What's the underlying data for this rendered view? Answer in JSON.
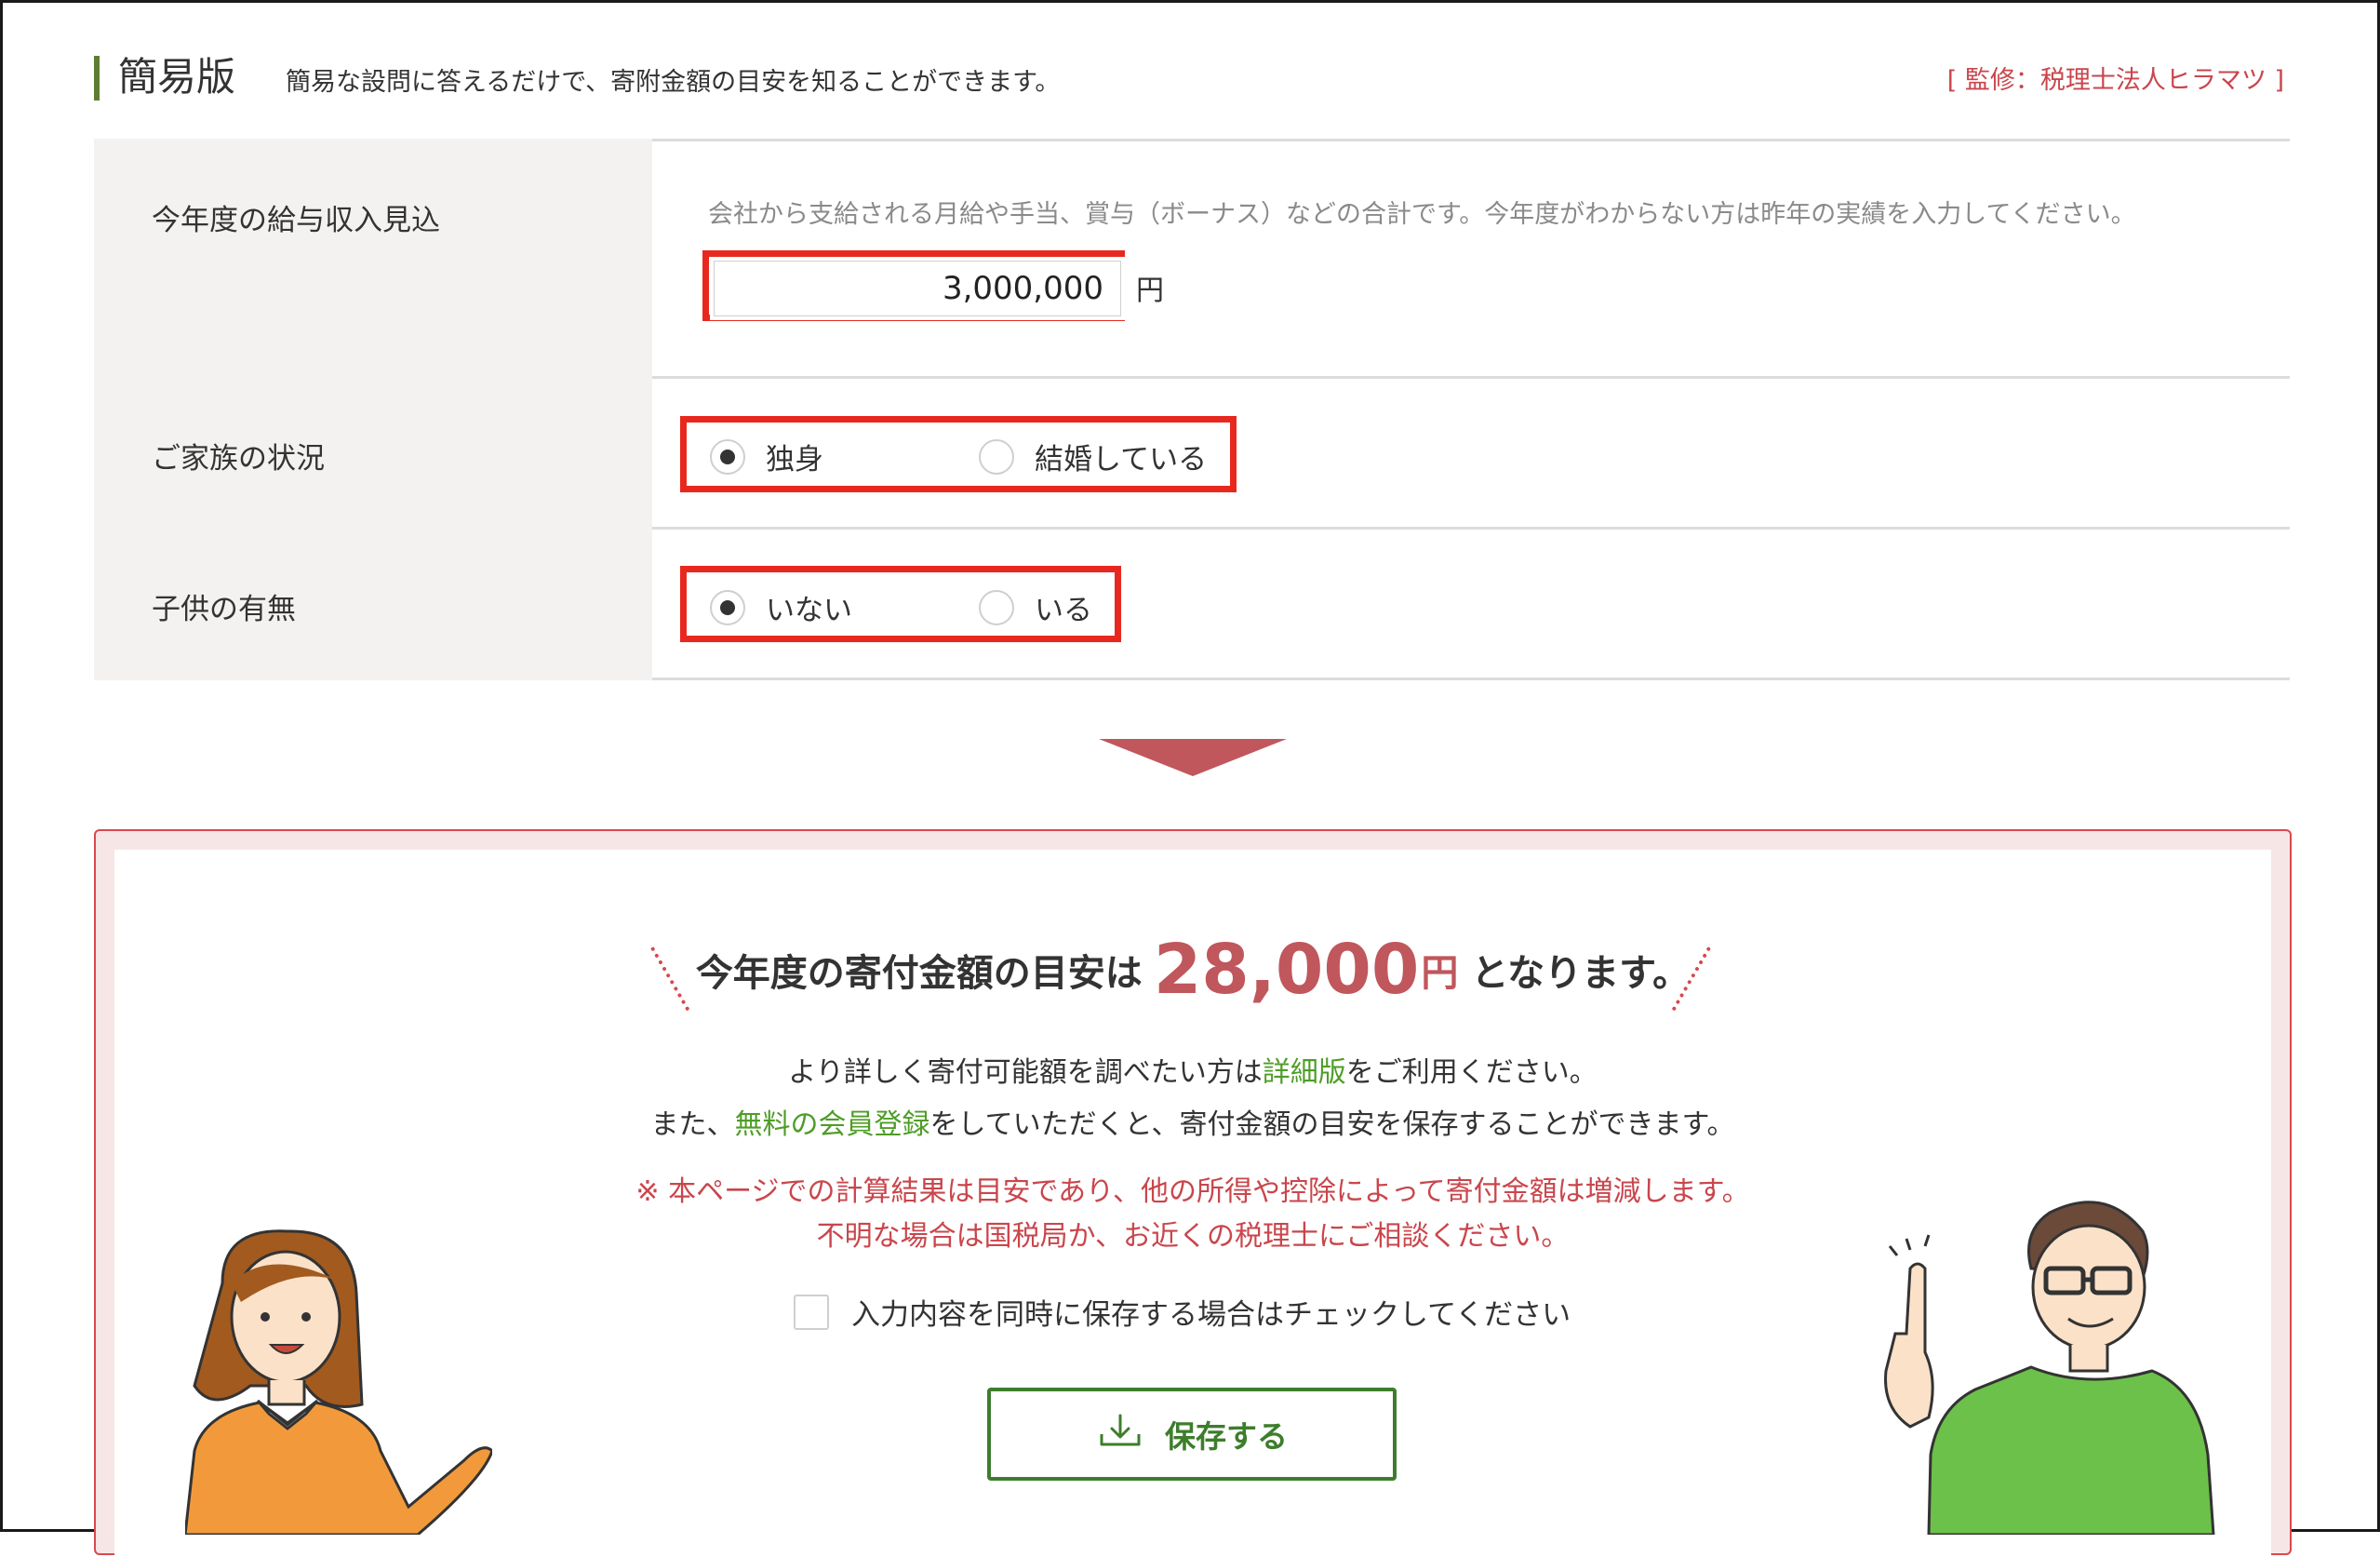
{
  "header": {
    "title": "簡易版",
    "subtitle": "簡易な設問に答えるだけで、寄附金額の目安を知ることができます。",
    "supervisor": "[ 監修：税理士法人ヒラマツ ]"
  },
  "form": {
    "income": {
      "label": "今年度の給与収入見込",
      "help": "会社から支給される月給や手当、賞与（ボーナス）などの合計です。今年度がわからない方は昨年の実績を入力してください。",
      "value": "3,000,000",
      "unit": "円"
    },
    "family": {
      "label": "ご家族の状況",
      "options": [
        {
          "label": "独身",
          "selected": true
        },
        {
          "label": "結婚している",
          "selected": false
        }
      ]
    },
    "children": {
      "label": "子供の有無",
      "options": [
        {
          "label": "いない",
          "selected": true
        },
        {
          "label": "いる",
          "selected": false
        }
      ]
    }
  },
  "colors": {
    "accent_red": "#c0575c",
    "highlight_red": "#e8281f",
    "green": "#3d7d2c",
    "title_bar_green": "#5e7d32"
  },
  "result": {
    "prefix": "今年度の寄付金額の目安は",
    "amount": "28,000",
    "yen": "円",
    "suffix": "となります。",
    "detail_pre": "より詳しく寄付可能額を調べたい方は",
    "detail_link": "詳細版",
    "detail_post": "をご利用ください。",
    "register_pre": "また、",
    "register_link": "無料の会員登録",
    "register_post": "をしていただくと、寄付金額の目安を保存することができます。",
    "note1": "※ 本ページでの計算結果は目安であり、他の所得や控除によって寄付金額は増減します。",
    "note2": "不明な場合は国税局か、お近くの税理士にご相談ください。",
    "checkbox_label": "入力内容を同時に保存する場合はチェックしてください",
    "save_button": "保存する"
  },
  "icons": [
    "download-icon",
    "radio-selected",
    "radio-unselected"
  ]
}
